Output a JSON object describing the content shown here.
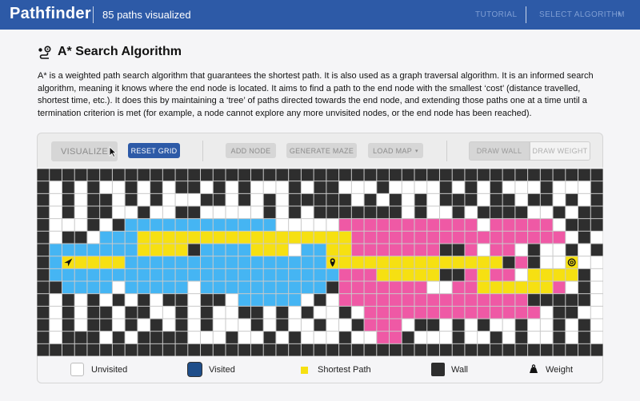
{
  "header": {
    "brand": "Pathfinder",
    "subtitle": "85 paths visualized",
    "nav_tutorial": "TUTORIAL",
    "nav_select_algorithm": "SELECT ALGORITHM",
    "caret": "▾"
  },
  "content": {
    "title": "A* Search Algorithm",
    "description": "A* is a weighted path search algorithm that guarantees the shortest path. It is also used as a graph traversal algorithm. It is an informed search algorithm, meaning it knows where the end node is located. It aims to find a path to the end node with the smallest ‘cost’ (distance travelled, shortest time, etc.). It does this by maintaining a ‘tree’ of paths directed towards the end node, and extending those paths one at a time until a termination criterion is met (for example, a node cannot explore any more unvisited nodes, or the end node has been reached)."
  },
  "toolbar": {
    "visualize": "VISUALIZE",
    "reset_grid": "RESET GRID",
    "add_node": "ADD NODE",
    "generate_maze": "GENERATE MAZE",
    "load_map": "LOAD MAP",
    "load_map_caret": "▾",
    "draw_wall": "DRAW WALL",
    "draw_weight": "DRAW WEIGHT"
  },
  "legend": {
    "unvisited": "Unvisited",
    "visited": "Visited",
    "shortest_path": "Shortest Path",
    "wall": "Wall",
    "weight": "Weight"
  },
  "colors": {
    "header": "#2d5aa7",
    "wall": "#2e2e2e",
    "unvisited": "#ffffff",
    "visited_start": "#45b5f3",
    "visited_mid": "#ef59a5",
    "shortest_path": "#f6e012",
    "legend_visited": "#1f4e8a"
  },
  "grid": {
    "rows": [
      "#############################################",
      "#.#.#..#.#.##.#.#...#.##...#....#.#.#...#...#",
      "#.#.##.#.#...##.#.#.#####.#.#.#.###.##.##.#.#",
      "#.#.##..#..##.....#.#.#######.#..#.####..#.##",
      "#...#.#bbbbbbbbbbbb.....ppppppppppp.ppppp.###",
      "#.##.bbbyyyyyyyyyyyyyyyyyppppppppppppppppp.#.#",
      "#bbbbbbbyyyy#bbbbyyy.bbyyppppppp##p.pp.#..#.#",
      "#bSyyyybbbbbbbbbbbbbbbbMyyyyyyyyyyyyy#p#..E..#",
      "#bbbbbbbbbbbbbbbbbbbbbbbpppyyyyy##pypp.yyyy#.#",
      "##bbbb.bbbbb.bbbbbbbbbb#ppppppp..ppyyyyyyp.#.#",
      "#.#.#.#.#.##.##.bbbbb.#.ppppppppppppppp#####.#",
      "#.#.##.##..#.#..##.#.#..#.pppppppppppppp.##..#",
      "#.#.##.#.#.#.#...#.#..#..#ppp.##.#.#..#..#.#.#",
      "#.###.#.####...#..#.#...#..pp#...#..#.#..#.#.#",
      "#############################################"
    ]
  }
}
